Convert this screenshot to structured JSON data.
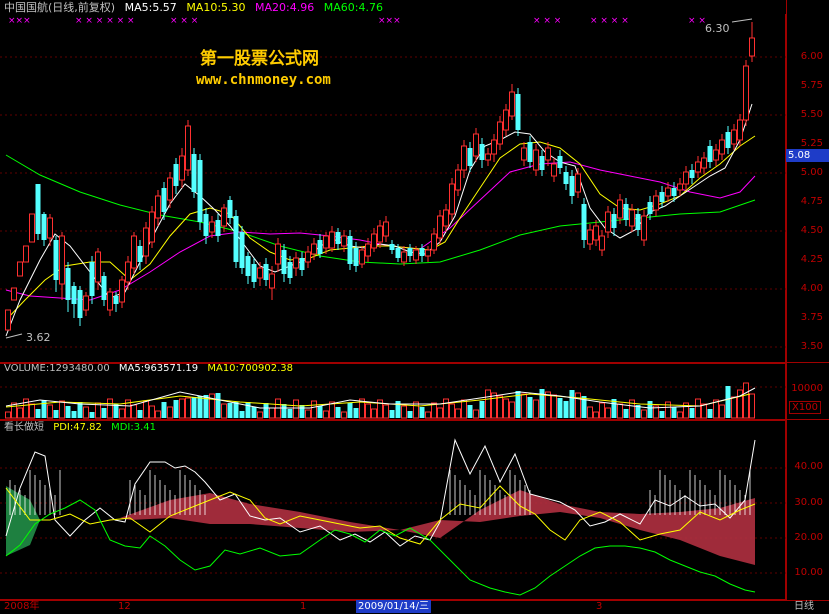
{
  "header": {
    "title": "中国国航(日线,前复权)",
    "ma5": "MA5:5.57",
    "ma10": "MA10:5.30",
    "ma20": "MA20:4.96",
    "ma60": "MA60:4.76"
  },
  "watermark": {
    "line1": "第一股票公式网",
    "line2": "www.chnmoney.com"
  },
  "price_panel": {
    "high_label": "6.30",
    "low_label": "3.62",
    "current_price": "5.08",
    "y_ticks": [
      "6.00",
      "5.75",
      "5.50",
      "5.25",
      "5.00",
      "4.75",
      "4.50",
      "4.25",
      "4.00",
      "3.75",
      "3.50"
    ]
  },
  "volume_panel": {
    "header": "VOLUME:1293480.00",
    "ma5": "MA5:963571.19",
    "ma10": "MA10:700902.38",
    "y_tick": "10000",
    "unit": "X100"
  },
  "indicator_panel": {
    "name": "看长做短",
    "pdi": "PDI:47.82",
    "mdi": "MDI:3.41",
    "y_ticks": [
      "40.00",
      "30.00",
      "20.00",
      "10.00"
    ]
  },
  "date_axis": {
    "labels": [
      "2008年",
      "12",
      "1",
      "2009/01/14/三",
      "3"
    ],
    "period": "日线"
  },
  "colors": {
    "up": "#ff3030",
    "down": "#54ffff",
    "ma5": "#ffffff",
    "ma10": "#ffff00",
    "ma20": "#ff00ff",
    "ma60": "#00ff00",
    "grid": "#a00000",
    "fill": "#b03040"
  }
}
